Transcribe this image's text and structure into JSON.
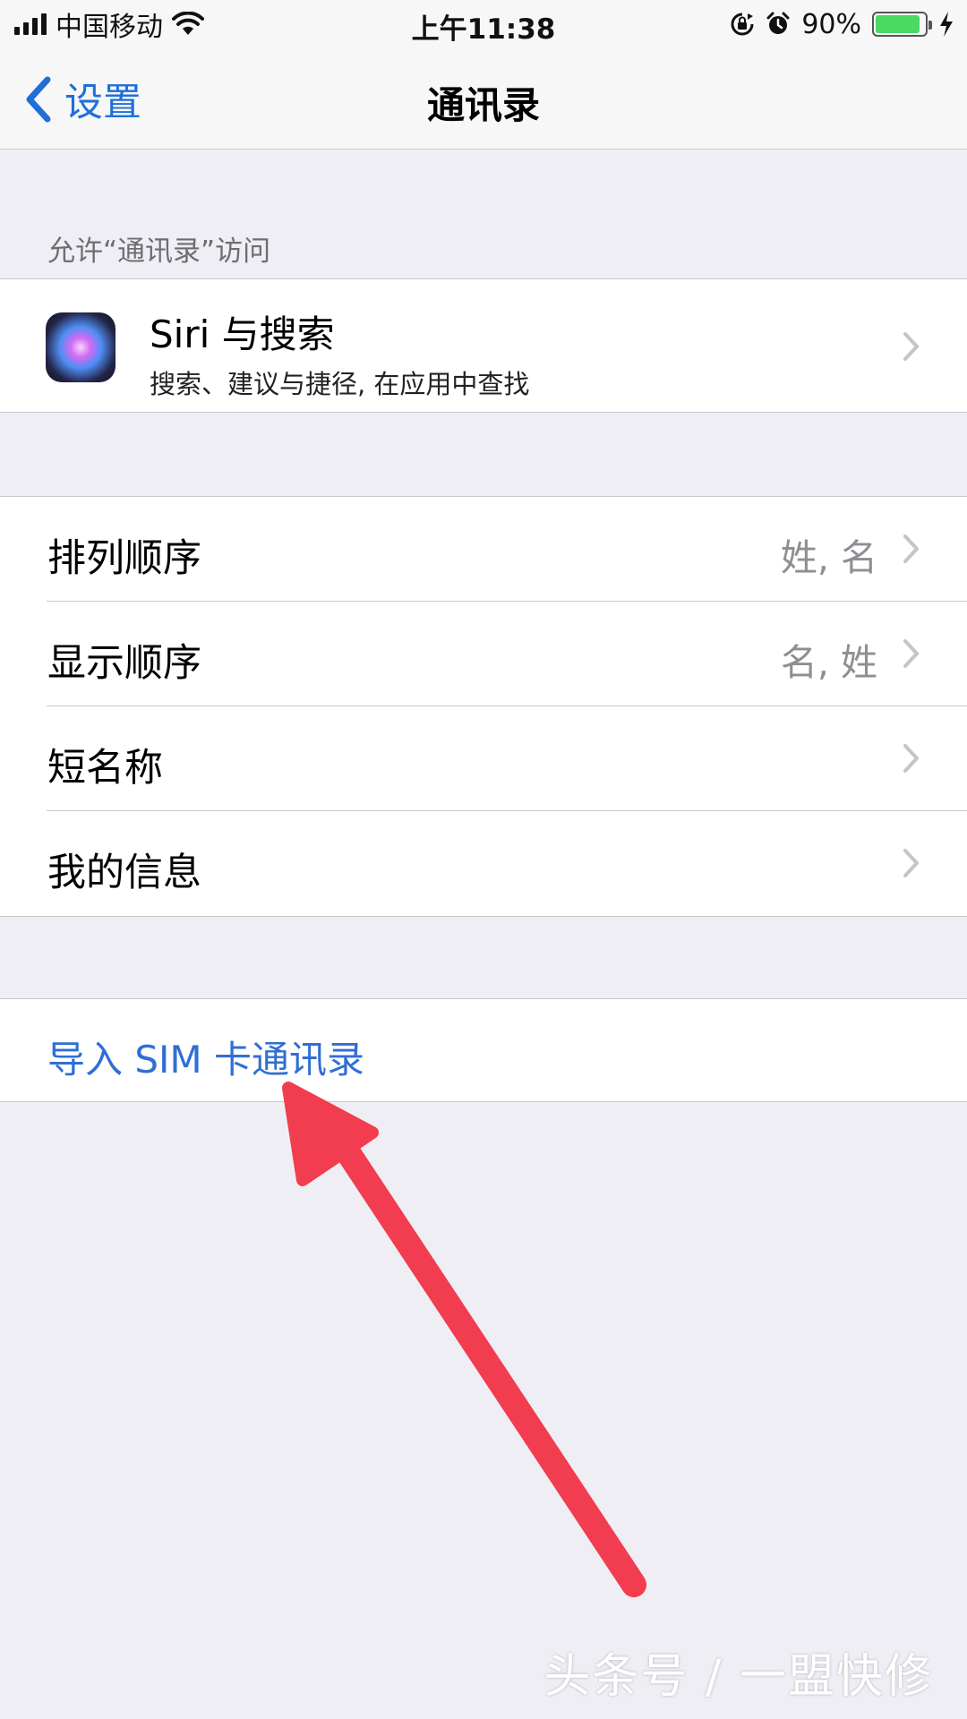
{
  "status_bar": {
    "carrier": "中国移动",
    "time": "上午11:38",
    "battery_percent": "90%",
    "battery_level": 0.9,
    "icons": [
      "signal-icon",
      "wifi-icon",
      "rotation-lock-icon",
      "alarm-icon",
      "battery-icon",
      "charging-icon"
    ]
  },
  "nav": {
    "back_label": "设置",
    "title": "通讯录"
  },
  "section_header": "允许“通讯录”访问",
  "siri": {
    "title": "Siri 与搜索",
    "subtitle": "搜索、建议与捷径, 在应用中查找"
  },
  "settings": [
    {
      "label": "排列顺序",
      "value": "姓, 名"
    },
    {
      "label": "显示顺序",
      "value": "名, 姓"
    },
    {
      "label": "短名称",
      "value": ""
    },
    {
      "label": "我的信息",
      "value": ""
    }
  ],
  "import": {
    "label": "导入 SIM 卡通讯录"
  },
  "watermark": "头条号 / 一盟快修",
  "colors": {
    "accent": "#1f6fd9",
    "link": "#2f6fd4",
    "arrow": "#f23c4f",
    "battery": "#4cd964"
  }
}
